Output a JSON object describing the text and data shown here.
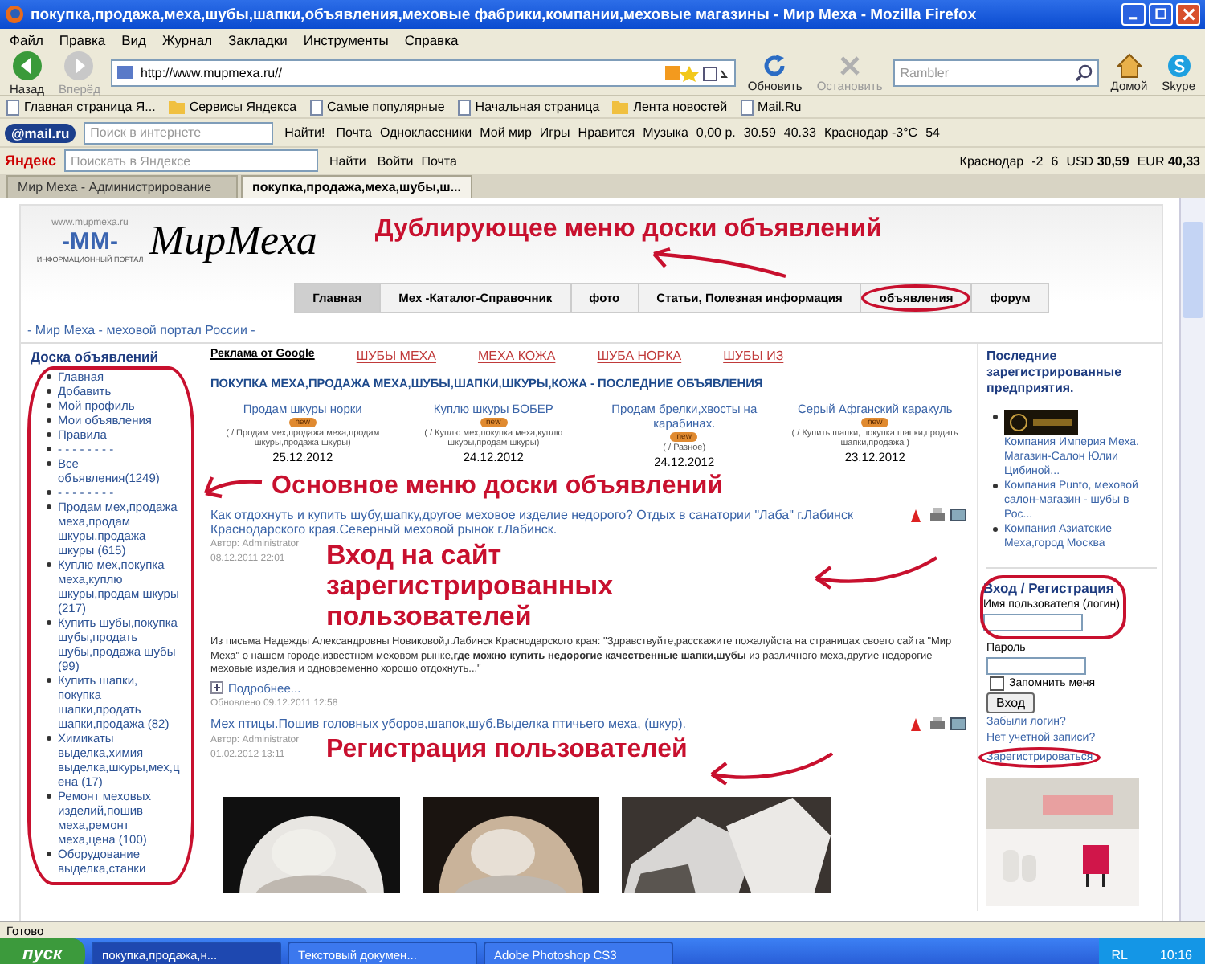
{
  "window": {
    "title": "покупка,продажа,меха,шубы,шапки,объявления,меховые фабрики,компании,меховые магазины - Мир Меха - Mozilla Firefox"
  },
  "menu": [
    "Файл",
    "Правка",
    "Вид",
    "Журнал",
    "Закладки",
    "Инструменты",
    "Справка"
  ],
  "nav_toolbar": {
    "left_buttons": [
      {
        "kind": "back",
        "label": "Назад",
        "disabled": false
      },
      {
        "kind": "forward",
        "label": "Вперёд",
        "disabled": true
      }
    ],
    "url": "http://www.mupmexa.ru//",
    "right_buttons": [
      {
        "kind": "reload",
        "label": "Обновить",
        "disabled": false
      },
      {
        "kind": "stop",
        "label": "Остановить",
        "disabled": true
      }
    ],
    "search_placeholder": "Rambler",
    "extra_buttons": [
      {
        "kind": "home",
        "label": "Домой"
      },
      {
        "kind": "skype",
        "label": "Skype"
      }
    ]
  },
  "bookmarks": [
    {
      "kind": "page",
      "label": "Главная страница Я..."
    },
    {
      "kind": "folder",
      "label": "Сервисы Яндекса"
    },
    {
      "kind": "page",
      "label": "Самые популярные"
    },
    {
      "kind": "page",
      "label": "Начальная страница"
    },
    {
      "kind": "folder",
      "label": "Лента новостей"
    },
    {
      "kind": "page",
      "label": "Mail.Ru"
    }
  ],
  "mail_toolbar": {
    "logo": "@mail.ru",
    "search_placeholder": "Поиск в интернете",
    "search_button": "Найти!",
    "items": [
      "Почта",
      "Одноклассники",
      "Мой мир",
      "Игры",
      "Нравится",
      "Музыка",
      "0,00 р.",
      "30.59",
      "40.33",
      "Краснодар -3°C",
      "54"
    ]
  },
  "yandex_toolbar": {
    "logo": "Яндекс",
    "search_placeholder": "Поискать в Яндексе",
    "search_button": "Найти",
    "items": [
      "Войти",
      "Почта"
    ],
    "right_items": [
      "Краснодар",
      "-2",
      "6",
      "USD **30,59**",
      "EUR **40,33**"
    ]
  },
  "tabs": [
    {
      "label": "Мир Меха - Администрирование",
      "selected": false
    },
    {
      "label": "покупка,продажа,меха,шубы,ш...",
      "selected": true
    }
  ],
  "site": {
    "logo_url": "www.mupmexa.ru",
    "logo_mark": "-MM-",
    "logo_caption": "ИНФОРМАЦИОННЫЙ ПОРТАЛ",
    "logo_title": "МирМеха",
    "nav": [
      {
        "label": "Главная",
        "selected": true
      },
      {
        "label": "Мех -Каталог-Справочник",
        "selected": false
      },
      {
        "label": "фото",
        "selected": false
      },
      {
        "label": "Статьи, Полезная информация",
        "selected": false
      },
      {
        "label": "объявления",
        "selected": false
      },
      {
        "label": "форум",
        "selected": false
      }
    ],
    "breadcrumb": "- Мир Меха - меховой портал России -"
  },
  "board_menu": {
    "title": "Доска объявлений",
    "items": [
      "Главная",
      "Добавить",
      "Мой профиль",
      "Мои объявления",
      "Правила",
      "- - - - - - - -",
      "Все объявления(1249)",
      "- - - - - - - -",
      "Продам мех,продажа меха,продам шкуры,продажа шкуры (615)",
      "Куплю мех,покупка меха,куплю шкуры,продам шкуры (217)",
      "Купить шубы,покупка шубы,продать шубы,продажа шубы (99)",
      "Купить шапки, покупка шапки,продать шапки,продажа (82)",
      "Химикаты выделка,химия выделка,шкуры,мех,цена (17)",
      "Ремонт меховых изделий,пошив меха,ремонт меха,цена (100)",
      "Оборудование выделка,станки"
    ]
  },
  "ads": {
    "label": "Реклама от Google",
    "links": [
      "ШУБЫ МЕХА",
      "МЕХА КОЖА",
      "ШУБА НОРКА",
      "ШУБЫ ИЗ"
    ]
  },
  "latest": {
    "title": "ПОКУПКА МЕХА,ПРОДАЖА МЕХА,ШУБЫ,ШАПКИ,ШКУРЫ,КОЖА - ПОСЛЕДНИЕ ОБЪЯВЛЕНИЯ",
    "listings": [
      {
        "title": "Продам шкуры норки",
        "badge": "new",
        "category": "( / Продам мех,продажа меха,продам шкуры,продажа шкуры)",
        "date": "25.12.2012"
      },
      {
        "title": "Куплю шкуры БОБЕР",
        "badge": "new",
        "category": "( / Куплю мех,покупка меха,куплю шкуры,продам шкуры)",
        "date": "24.12.2012"
      },
      {
        "title": "Продам брелки,хвосты на карабинах.",
        "badge": "new",
        "category": "( / Разное)",
        "date": "24.12.2012"
      },
      {
        "title": "Серый Афганский каракуль",
        "badge": "new",
        "category": "( / Купить шапки, покупка шапки,продать шапки,продажа )",
        "date": "23.12.2012"
      }
    ]
  },
  "articles": [
    {
      "title": "Как отдохнуть и купить шубу,шапку,другое меховое изделие недорого? Отдых в санатории \"Лаба\" г.Лабинск Краснодарского края.Северный меховой рынок г.Лабинск.",
      "author": "Автор: Administrator",
      "date": "08.12.2011 22:01",
      "text": "Из письма Надежды Александровны Новиковой,г.Лабинск Краснодарского края: \"Здравствуйте,расскажите пожалуйста на страницах своего сайта \"Мир Меха\" о нашем городе,известном меховом рынке,**где можно купить недорогие качественные шапки,шубы** из различного меха,другие недорогие меховые изделия и одновременно хорошо отдохнуть...\"",
      "more": "Подробнее...",
      "updated": "Обновлено 09.12.2011 12:58"
    },
    {
      "title": "Мех птицы.Пошив головных уборов,шапок,шуб.Выделка птичьего меха, (шкур).",
      "author": "Автор: Administrator",
      "date": "01.02.2012 13:11"
    }
  ],
  "companies": {
    "title": "Последние зарегистрированные предприятия.",
    "items": [
      {
        "kind": "with_logo",
        "text": "Компания Империя Меха. Магазин-Салон Юлии Цибиной..."
      },
      {
        "kind": "plain",
        "text": "Компания Punto, меховой салон-магазин - шубы в Рос..."
      },
      {
        "kind": "plain",
        "text": "Компания Азиатские Меха,город Москва"
      }
    ]
  },
  "login": {
    "title": "Вход / Регистрация",
    "user_label": "Имя пользователя (логин)",
    "password_label": "Пароль",
    "remember_label": "Запомнить меня",
    "remember_checked": false,
    "button": "Вход",
    "links": [
      "Забыли логин?",
      "Нет учетной записи?",
      "Зарегистрироваться"
    ]
  },
  "annotations": [
    "Дублирующее меню доски объявлений",
    "Основное меню доски объявлений",
    "Вход на сайт зарегистрированных пользователей",
    "Регистрация пользователей"
  ],
  "status_bar": "Готово",
  "taskbar": {
    "start": "пуск",
    "tasks": [
      {
        "label": "покупка,продажа,н...",
        "selected": true
      },
      {
        "label": "Текстовый докумен...",
        "selected": false
      },
      {
        "label": "Adobe Photoshop CS3",
        "selected": false
      }
    ],
    "lang": "RL",
    "time": "10:16"
  }
}
